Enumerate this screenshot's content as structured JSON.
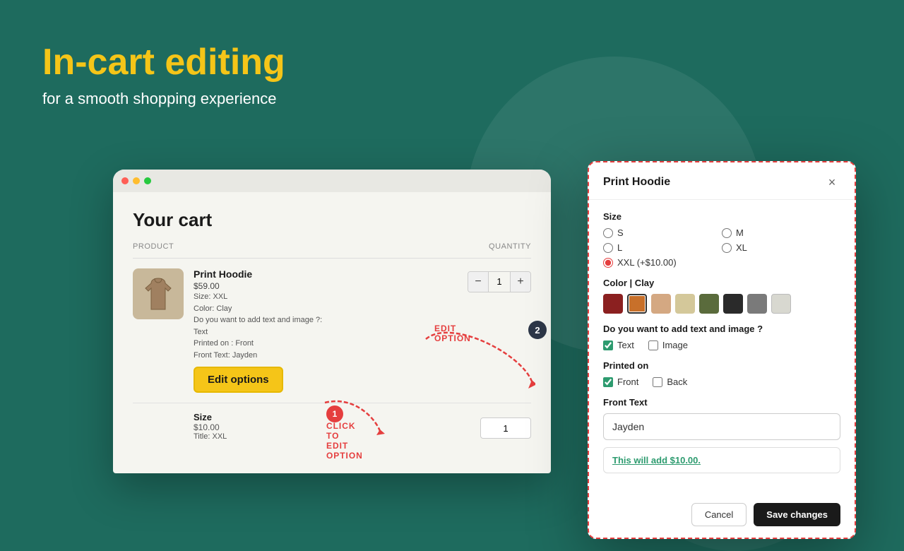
{
  "page": {
    "bg_color": "#1e6b5e"
  },
  "hero": {
    "title": "In-cart editing",
    "subtitle": "for a smooth shopping experience"
  },
  "cart": {
    "title": "Your cart",
    "table_headers": {
      "product": "PRODUCT",
      "quantity": "QUANTITY"
    },
    "items": [
      {
        "name": "Print Hoodie",
        "price": "$59.00",
        "details": [
          "Size: XXL",
          "Color: Clay",
          "Do you want to add text and image ?:",
          "Text",
          "Printed on : Front",
          "Front Text: Jayden"
        ],
        "qty": 1
      },
      {
        "name": "Size",
        "price": "$10.00",
        "details": [
          "Title: XXL"
        ],
        "qty": 1
      }
    ],
    "edit_options_label": "Edit options",
    "step1_label": "1",
    "click_annotation": "CLICK TO EDIT OPTION",
    "edit_option_annotation": "EDIT OPTION"
  },
  "modal": {
    "title": "Print Hoodie",
    "close_label": "×",
    "size_label": "Size",
    "size_options": [
      {
        "label": "S",
        "checked": false
      },
      {
        "label": "M",
        "checked": false
      },
      {
        "label": "L",
        "checked": false
      },
      {
        "label": "XL",
        "checked": false
      },
      {
        "label": "XXL (+$10.00)",
        "checked": true
      }
    ],
    "color_label": "Color | Clay",
    "colors": [
      {
        "hex": "#8B2020",
        "selected": false
      },
      {
        "hex": "#c8702a",
        "selected": true
      },
      {
        "hex": "#d4a882",
        "selected": false
      },
      {
        "hex": "#d4c89a",
        "selected": false
      },
      {
        "hex": "#5a6b3c",
        "selected": false
      },
      {
        "hex": "#2a2a2a",
        "selected": false
      },
      {
        "hex": "#7a7a7a",
        "selected": false
      },
      {
        "hex": "#d8d8d0",
        "selected": false
      }
    ],
    "add_text_image_label": "Do you want to add text and image ?",
    "text_checkbox": {
      "label": "Text",
      "checked": true
    },
    "image_checkbox": {
      "label": "Image",
      "checked": false
    },
    "printed_on_label": "Printed on",
    "front_checkbox": {
      "label": "Front",
      "checked": true
    },
    "back_checkbox": {
      "label": "Back",
      "checked": false
    },
    "front_text_label": "Front Text",
    "front_text_value": "Jayden",
    "front_text_placeholder": "Jayden",
    "info_text": "This will add ",
    "info_price": "$10.00",
    "info_suffix": ".",
    "cancel_label": "Cancel",
    "save_label": "Save changes",
    "step2_label": "2"
  },
  "annotations": {
    "edit_option": "EDIT OPTION",
    "click_to_edit": "CLICK TO EDIT OPTION"
  }
}
